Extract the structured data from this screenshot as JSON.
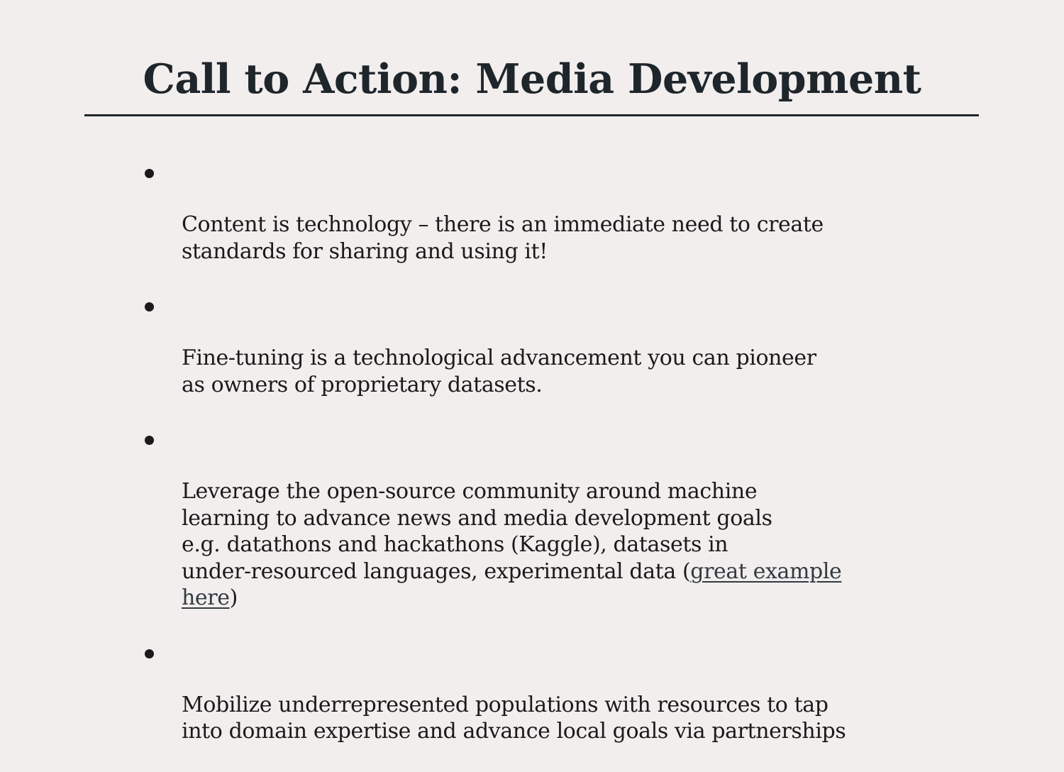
{
  "slide": {
    "title": "Call to Action: Media Development",
    "bullets": [
      {
        "text": "Content is technology – there is an immediate need to create\nstandards for sharing and using it!"
      },
      {
        "text": "Fine-tuning is a technological advancement you can pioneer\nas owners of proprietary datasets."
      },
      {
        "text_before_link": "Leverage the open-source community around machine\nlearning to advance news and media development goals\ne.g. datathons and hackathons (Kaggle), datasets in\nunder-resourced languages, experimental data (",
        "link_text": "great example\nhere",
        "text_after_link": ")"
      },
      {
        "text": "Mobilize underrepresented populations with resources to tap\ninto domain expertise and advance local goals via partnerships"
      }
    ]
  }
}
